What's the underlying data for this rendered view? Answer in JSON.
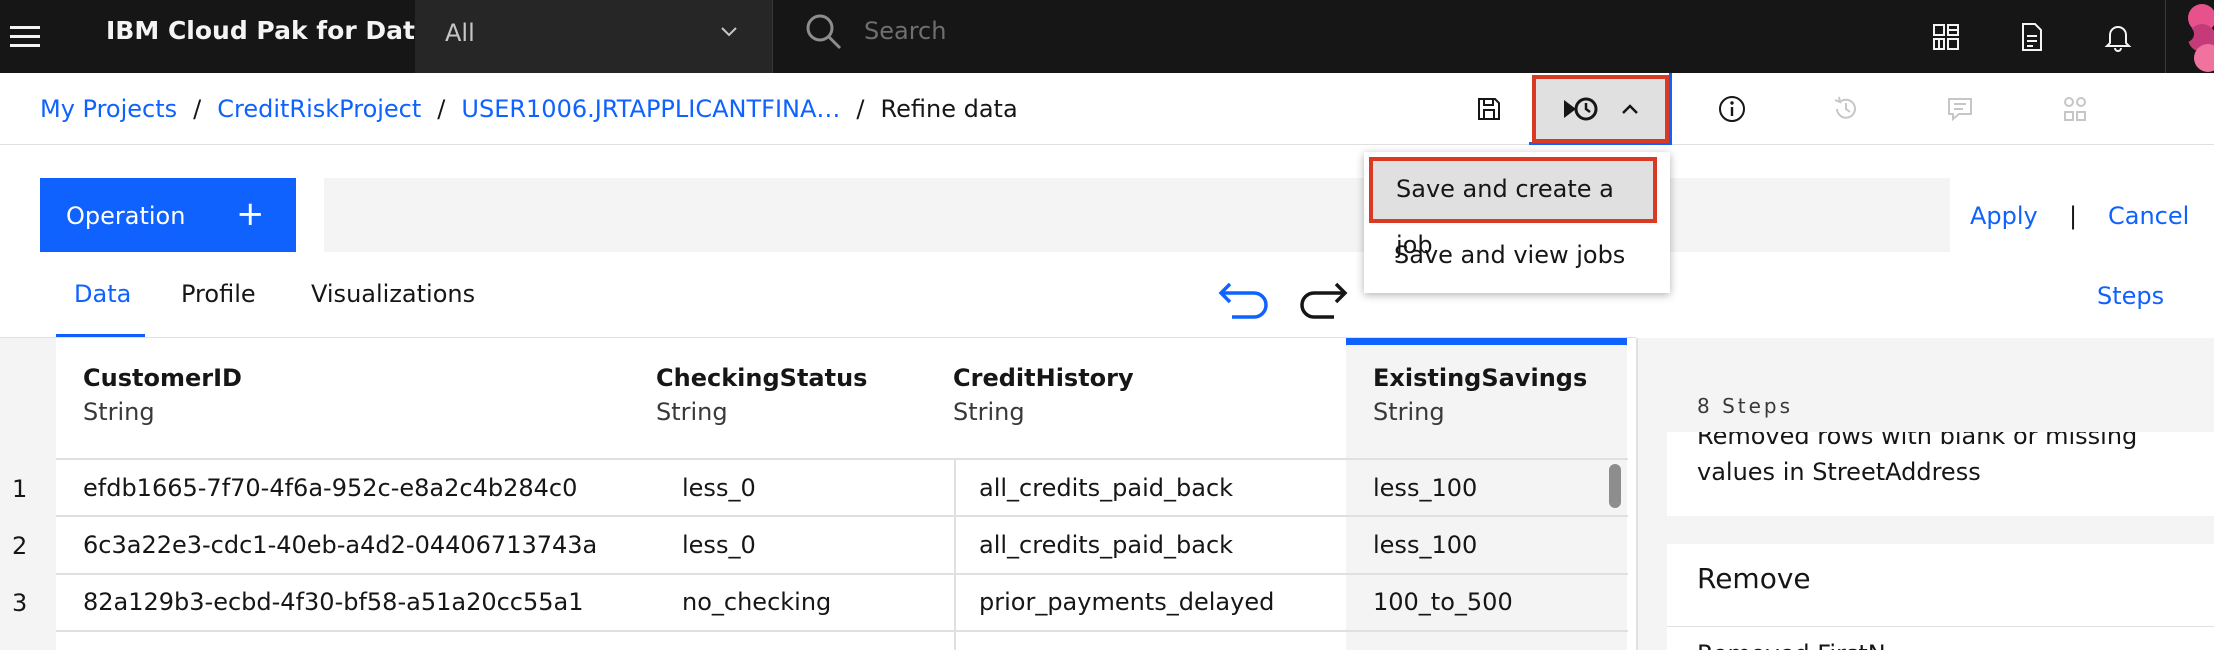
{
  "header": {
    "product_name": "IBM Cloud Pak for Data",
    "scope_value": "All",
    "search_placeholder": "Search"
  },
  "breadcrumb": {
    "items": [
      "My Projects",
      "CreditRiskProject",
      "USER1006.JRTAPPLICANTFINA…"
    ],
    "current": "Refine data"
  },
  "job_menu": {
    "items": [
      "Save and create a job",
      "Save and view jobs"
    ],
    "highlight_color": "#da3a23"
  },
  "operation": {
    "button_label": "Operation",
    "plus": "+",
    "apply_label": "Apply",
    "separator": "|",
    "cancel_label": "Cancel"
  },
  "tabs": [
    "Data",
    "Profile",
    "Visualizations"
  ],
  "active_tab": "Data",
  "steps_link": "Steps",
  "table": {
    "columns": [
      {
        "name": "CustomerID",
        "type": "String"
      },
      {
        "name": "CheckingStatus",
        "type": "String"
      },
      {
        "name": "CreditHistory",
        "type": "String"
      },
      {
        "name": "ExistingSavings",
        "type": "String",
        "selected": true
      }
    ],
    "rows": [
      {
        "num": "1",
        "cells": [
          "efdb1665-7f70-4f6a-952c-e8a2c4b284c0",
          "less_0",
          "all_credits_paid_back",
          "less_100"
        ]
      },
      {
        "num": "2",
        "cells": [
          "6c3a22e3-cdc1-40eb-a4d2-04406713743a",
          "less_0",
          "all_credits_paid_back",
          "less_100"
        ]
      },
      {
        "num": "3",
        "cells": [
          "82a129b3-ecbd-4f30-bf58-a51a20cc55a1",
          "no_checking",
          "prior_payments_delayed",
          "100_to_500"
        ]
      }
    ]
  },
  "steps_panel": {
    "count_label": "8 Steps",
    "step_text": "Removed rows with blank or missing values in StreetAddress",
    "next_title": "Remove",
    "next_sub": "Removed FirstN…"
  },
  "colors": {
    "accent": "#0f62fe",
    "topbar": "#161616",
    "highlight_border": "#da3a23"
  }
}
